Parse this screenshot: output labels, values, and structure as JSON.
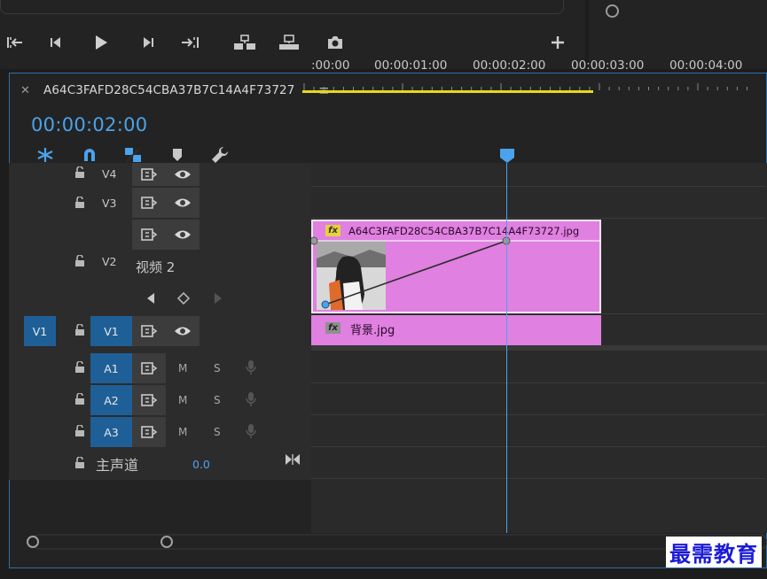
{
  "sequence": {
    "title": "A64C3FAFD28C54CBA37B7C14A4F73727",
    "timecode": "00:00:02:00"
  },
  "ruler": {
    "labels": [
      ":00:00",
      "00:00:01:00",
      "00:00:02:00",
      "00:00:03:00",
      "00:00:04:00"
    ]
  },
  "tracks": {
    "v4": "V4",
    "v3": "V3",
    "v2": "V2",
    "v2_name": "视频 2",
    "v1_source": "V1",
    "v1": "V1",
    "a1": "A1",
    "a2": "A2",
    "a3": "A3",
    "mute": "M",
    "solo": "S",
    "master": "主声道",
    "master_value": "0.0"
  },
  "clips": {
    "upper": {
      "name": "A64C3FAFD28C54CBA37B7C14A4F73727.jpg",
      "fx": "fx"
    },
    "lower": {
      "name": "背景.jpg",
      "fx": "fx"
    }
  },
  "colors": {
    "accent": "#4aa3ec",
    "clip": "#e080e0",
    "track_target": "#1f5f97",
    "work_area": "#e5d81e"
  },
  "watermark": "最需教育"
}
